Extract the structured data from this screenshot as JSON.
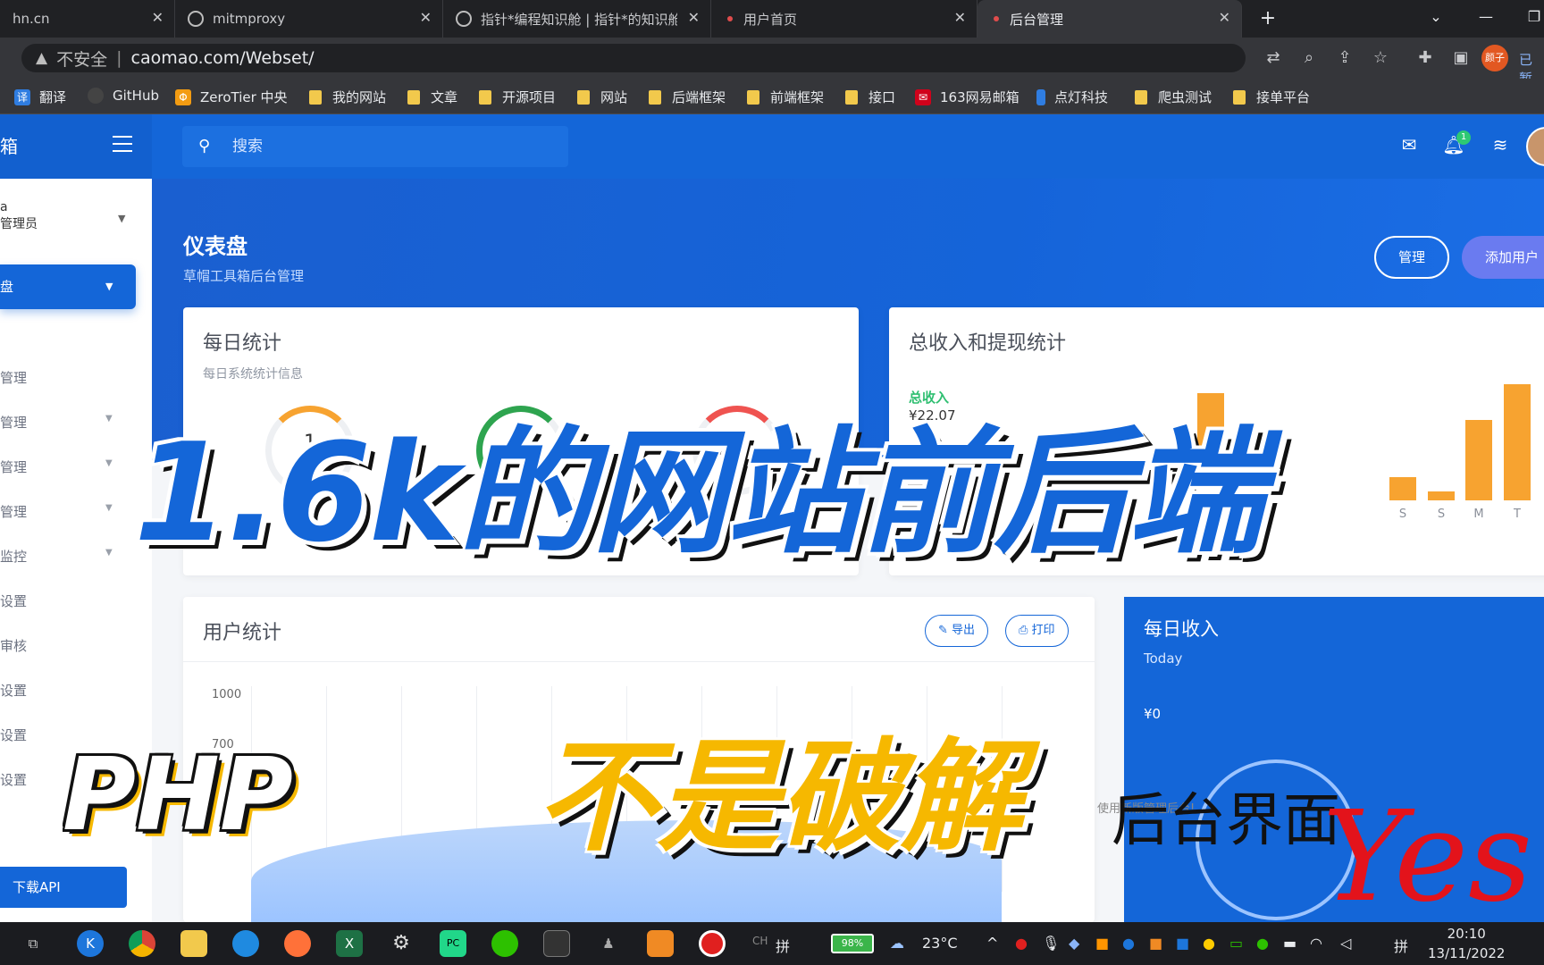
{
  "browser": {
    "tabs": [
      {
        "title": "hn.cn"
      },
      {
        "title": "mitmproxy"
      },
      {
        "title": "指针*编程知识舱 | 指针*的知识舱"
      },
      {
        "title": "用户首页"
      },
      {
        "title": "后台管理"
      }
    ],
    "address": {
      "security": "不安全",
      "url": "caomao.com/Webset/"
    },
    "synced_label": "已暂",
    "profile_label": "颜子",
    "bookmarks": [
      "翻译",
      "GitHub",
      "ZeroTier 中央",
      "我的网站",
      "文章",
      "开源项目",
      "网站",
      "后端框架",
      "前端框架",
      "接口",
      "163网易邮箱",
      "点灯科技",
      "爬虫测试",
      "接单平台"
    ]
  },
  "app": {
    "brand": "箱",
    "search_placeholder": "搜索",
    "notification_count": "1",
    "sidebar": {
      "user_top": "a",
      "user_role": "管理员",
      "active": "盘",
      "items": [
        "管理",
        "管理",
        "管理",
        "管理",
        "监控",
        "设置",
        "审核",
        "设置",
        "设置",
        "设置"
      ],
      "download": "下载API"
    },
    "page_title": "仪表盘",
    "page_subtitle": "草帽工具箱后台管理",
    "btn_manage": "管理",
    "btn_add_user": "添加用户",
    "daily_stats": {
      "title": "每日统计",
      "subtitle": "每日系统统计信息",
      "gauge_value": "1"
    },
    "income_stats": {
      "title": "总收入和提现统计",
      "label": "总收入",
      "value": "¥22.07",
      "days": [
        "S",
        "S",
        "M",
        "T"
      ]
    },
    "user_stats": {
      "title": "用户统计",
      "export": "导出",
      "print": "打印",
      "ytick_top": "1000",
      "ytick_mid": "700"
    },
    "daily_income": {
      "title": "每日收入",
      "subtitle": "Today",
      "value": "¥0"
    },
    "notice": "使用新版管理后台!"
  },
  "overlay": {
    "headline": "1.6k的网站前后端",
    "php": "PHP",
    "not_cracked": "不是破解",
    "partial_text": "后台界面",
    "yes": "Yes"
  },
  "taskbar": {
    "battery": "98%",
    "temperature": "23°C",
    "ime": "拼",
    "time": "20:10",
    "date": "13/11/2022"
  },
  "colors": {
    "primary": "#1466d8",
    "accent_orange": "#f7a330",
    "success_green": "#2ec973",
    "caption_yellow": "#f6b800",
    "caption_red": "#e3131b"
  }
}
